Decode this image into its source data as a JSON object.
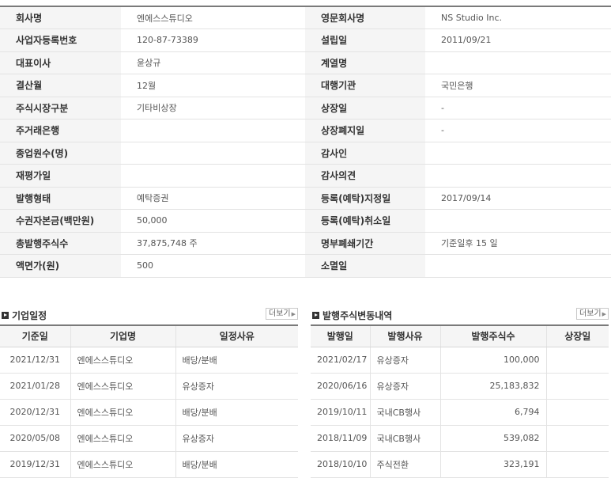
{
  "company_info": [
    {
      "label1": "회사명",
      "value1": "엔에스스튜디오",
      "label2": "영문회사명",
      "value2": "NS Studio Inc."
    },
    {
      "label1": "사업자등록번호",
      "value1": "120-87-73389",
      "label2": "설립일",
      "value2": "2011/09/21"
    },
    {
      "label1": "대표이사",
      "value1": "윤상규",
      "label2": "계열명",
      "value2": ""
    },
    {
      "label1": "결산월",
      "value1": "12월",
      "label2": "대행기관",
      "value2": "국민은행"
    },
    {
      "label1": "주식시장구분",
      "value1": "기타비상장",
      "label2": "상장일",
      "value2": "-"
    },
    {
      "label1": "주거래은행",
      "value1": "",
      "label2": "상장폐지일",
      "value2": "-"
    },
    {
      "label1": "종업원수(명)",
      "value1": "",
      "label2": "감사인",
      "value2": ""
    },
    {
      "label1": "재평가일",
      "value1": "",
      "label2": "감사의견",
      "value2": ""
    },
    {
      "label1": "발행형태",
      "value1": "예탁증권",
      "label2": "등록(예탁)지정일",
      "value2": "2017/09/14"
    },
    {
      "label1": "수권자본금(백만원)",
      "value1": "50,000",
      "label2": "등록(예탁)취소일",
      "value2": ""
    },
    {
      "label1": "총발행주식수",
      "value1": "37,875,748 주",
      "label2": "명부폐쇄기간",
      "value2": "기준일후 15 일"
    },
    {
      "label1": "액면가(원)",
      "value1": "500",
      "label2": "소멸일",
      "value2": ""
    }
  ],
  "schedule": {
    "title": "기업일정",
    "more_label": "더보기",
    "more_arrow": "▶",
    "icon": "square-bullet-icon",
    "headers": [
      "기준일",
      "기업명",
      "일정사유"
    ],
    "rows": [
      [
        "2021/12/31",
        "엔에스스튜디오",
        "배당/분배"
      ],
      [
        "2021/01/28",
        "엔에스스튜디오",
        "유상증자"
      ],
      [
        "2020/12/31",
        "엔에스스튜디오",
        "배당/분배"
      ],
      [
        "2020/05/08",
        "엔에스스튜디오",
        "유상증자"
      ],
      [
        "2019/12/31",
        "엔에스스튜디오",
        "배당/분배"
      ]
    ]
  },
  "share_changes": {
    "title": "발행주식변동내역",
    "more_label": "더보기",
    "more_arrow": "▶",
    "icon": "square-bullet-icon",
    "headers": [
      "발행일",
      "발행사유",
      "발행주식수",
      "상장일"
    ],
    "rows": [
      [
        "2021/02/17",
        "유상증자",
        "100,000",
        ""
      ],
      [
        "2020/06/16",
        "유상증자",
        "25,183,832",
        ""
      ],
      [
        "2019/10/11",
        "국내CB행사",
        "6,794",
        ""
      ],
      [
        "2018/11/09",
        "국내CB행사",
        "539,082",
        ""
      ],
      [
        "2018/10/10",
        "주식전환",
        "323,191",
        ""
      ]
    ]
  },
  "colors": {
    "label_bg": "#f5f5f5",
    "top_border": "#7a7a7a",
    "row_border": "#e3e3e3"
  }
}
